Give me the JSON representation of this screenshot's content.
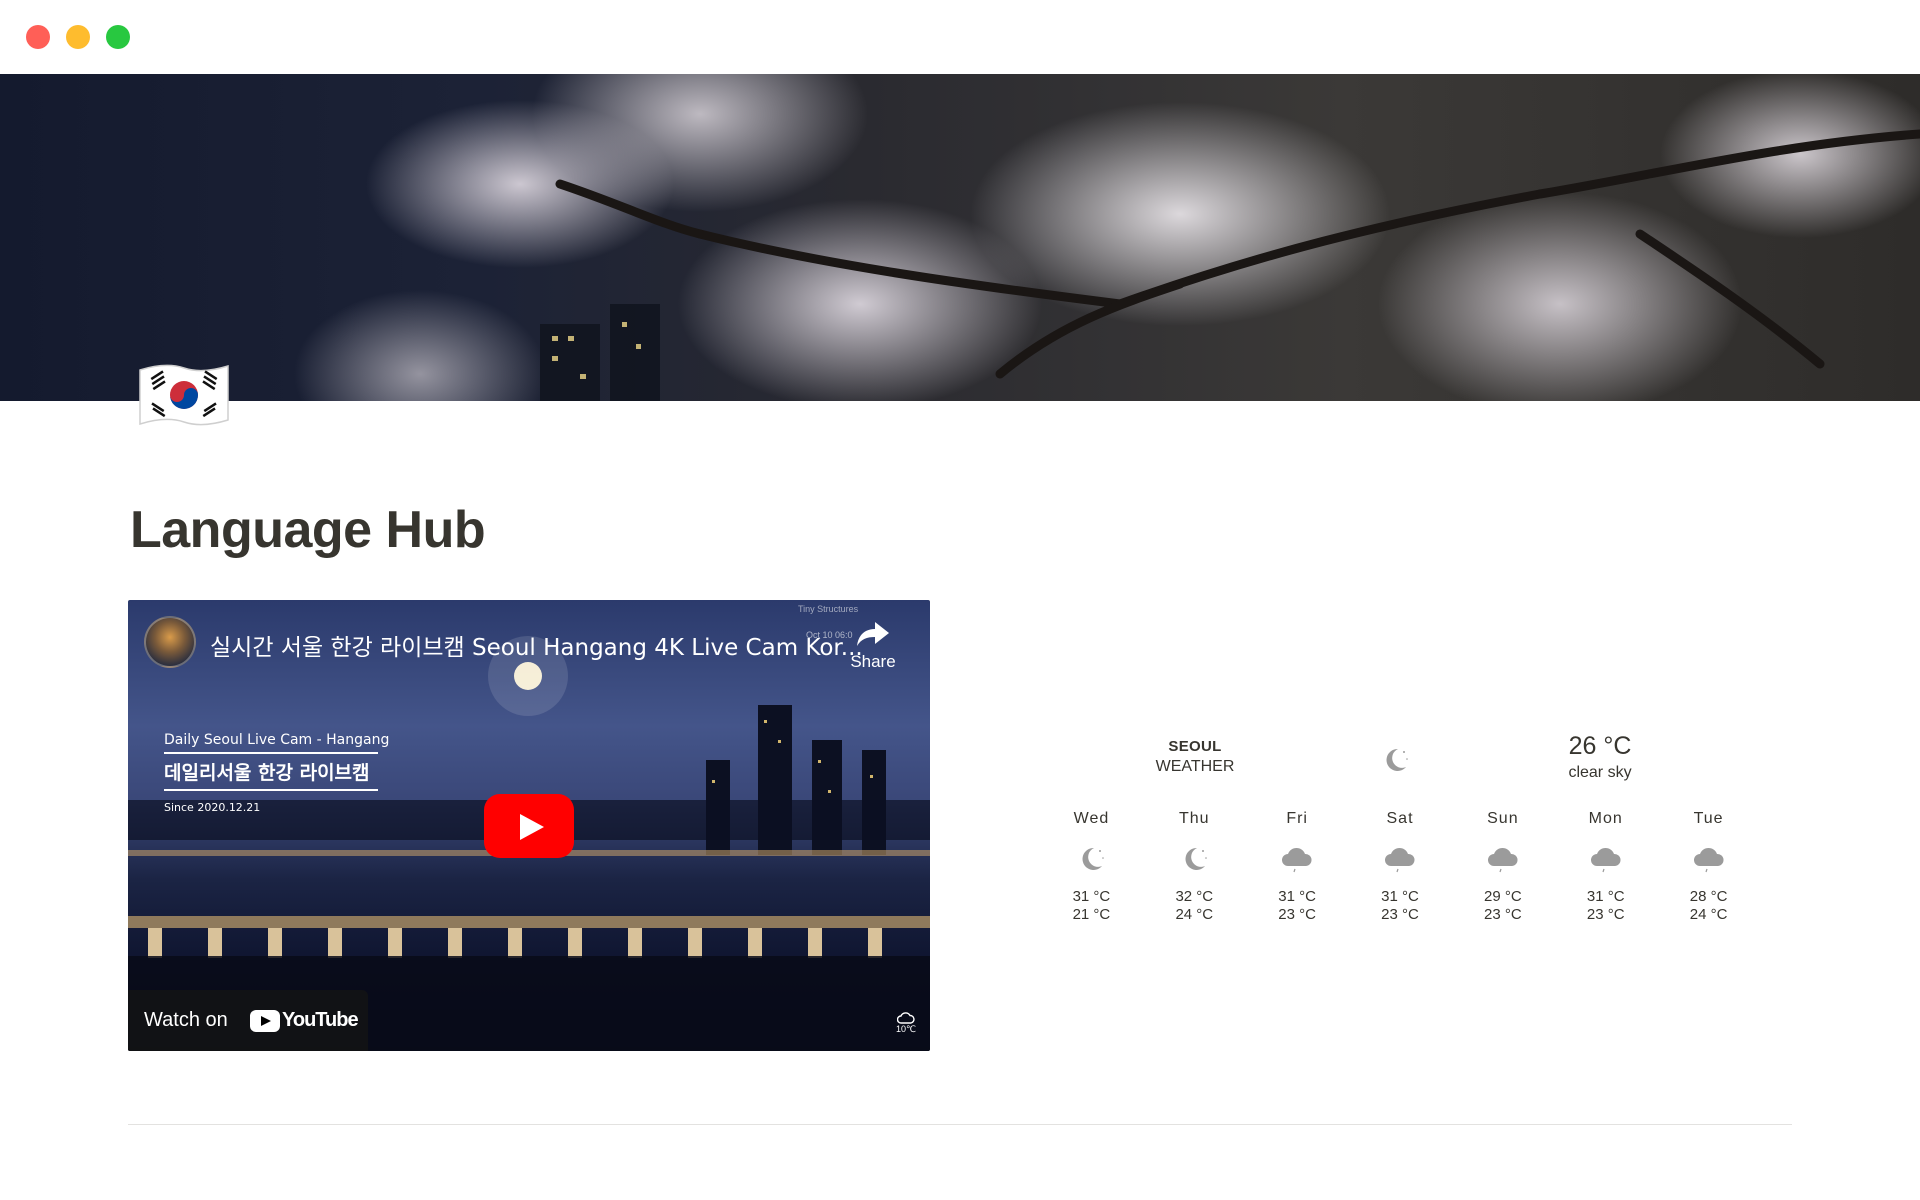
{
  "window": {
    "controls": [
      "close",
      "minimize",
      "maximize"
    ]
  },
  "page": {
    "title": "Language Hub",
    "icon": "south-korea-flag-icon"
  },
  "video": {
    "title": "실시간 서울 한강 라이브캠 Seoul Hangang 4K Live Cam Kor...",
    "share_label": "Share",
    "overlay_top_right": "Tiny Structures",
    "overlay_date": "Oct 10 06:0",
    "caption_en": "Daily Seoul Live Cam - Hangang",
    "caption_ko": "데일리서울 한강 라이브캠",
    "caption_since": "Since 2020.12.21",
    "watch_on": "Watch on",
    "youtube": "YouTube",
    "cam_temp": "10℃"
  },
  "weather": {
    "city": "SEOUL",
    "label": "WEATHER",
    "current_temp": "26 °C",
    "current_desc": "clear sky",
    "current_icon": "moon-icon",
    "days": [
      {
        "name": "Wed",
        "icon": "moon-icon",
        "hi": "31 °C",
        "lo": "21 °C"
      },
      {
        "name": "Thu",
        "icon": "moon-icon",
        "hi": "32 °C",
        "lo": "24 °C"
      },
      {
        "name": "Fri",
        "icon": "cloud-icon",
        "hi": "31 °C",
        "lo": "23 °C"
      },
      {
        "name": "Sat",
        "icon": "cloud-icon",
        "hi": "31 °C",
        "lo": "23 °C"
      },
      {
        "name": "Sun",
        "icon": "cloud-icon",
        "hi": "29 °C",
        "lo": "23 °C"
      },
      {
        "name": "Mon",
        "icon": "cloud-icon",
        "hi": "31 °C",
        "lo": "23 °C"
      },
      {
        "name": "Tue",
        "icon": "cloud-icon",
        "hi": "28 °C",
        "lo": "24 °C"
      }
    ]
  },
  "colors": {
    "text": "#37352f",
    "play": "#ff0000",
    "divider": "#e3e2e0"
  }
}
